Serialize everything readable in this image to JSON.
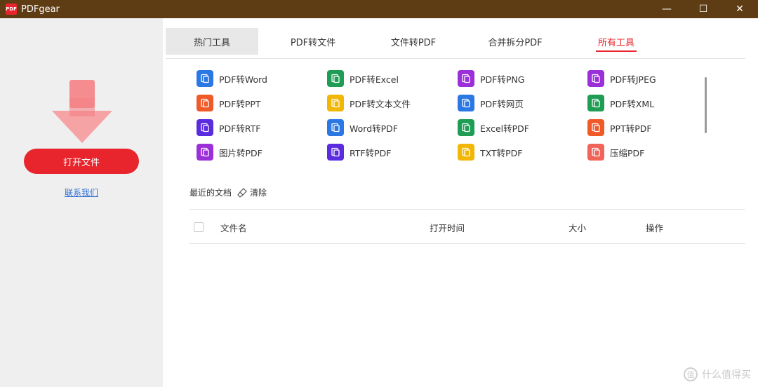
{
  "window": {
    "title": "PDFgear",
    "logo_text": "PDF",
    "minimize": "—",
    "maximize": "☐",
    "close": "✕"
  },
  "sidebar": {
    "open_file": "打开文件",
    "contact_us": "联系我们"
  },
  "tabs": [
    {
      "label": "热门工具"
    },
    {
      "label": "PDF转文件"
    },
    {
      "label": "文件转PDF"
    },
    {
      "label": "合并拆分PDF"
    },
    {
      "label": "所有工具"
    }
  ],
  "tools": [
    {
      "label": "PDF转Word",
      "color": "#2b78e4",
      "icon": "word-icon"
    },
    {
      "label": "PDF转Excel",
      "color": "#1f9d55",
      "icon": "excel-icon"
    },
    {
      "label": "PDF转PNG",
      "color": "#9b30d9",
      "icon": "png-icon"
    },
    {
      "label": "PDF转JPEG",
      "color": "#9b30d9",
      "icon": "jpeg-icon"
    },
    {
      "label": "PDF转PPT",
      "color": "#f05a28",
      "icon": "ppt-icon"
    },
    {
      "label": "PDF转文本文件",
      "color": "#f2b705",
      "icon": "text-icon"
    },
    {
      "label": "PDF转网页",
      "color": "#2b78e4",
      "icon": "web-icon"
    },
    {
      "label": "PDF转XML",
      "color": "#1f9d55",
      "icon": "xml-icon"
    },
    {
      "label": "PDF转RTF",
      "color": "#5b2be0",
      "icon": "rtf-icon"
    },
    {
      "label": "Word转PDF",
      "color": "#2b78e4",
      "icon": "word-to-pdf-icon"
    },
    {
      "label": "Excel转PDF",
      "color": "#1f9d55",
      "icon": "excel-to-pdf-icon"
    },
    {
      "label": "PPT转PDF",
      "color": "#f05a28",
      "icon": "ppt-to-pdf-icon"
    },
    {
      "label": "图片转PDF",
      "color": "#9b30d9",
      "icon": "image-to-pdf-icon"
    },
    {
      "label": "RTF转PDF",
      "color": "#5b2be0",
      "icon": "rtf-to-pdf-icon"
    },
    {
      "label": "TXT转PDF",
      "color": "#f2b705",
      "icon": "txt-to-pdf-icon"
    },
    {
      "label": "压缩PDF",
      "color": "#f0645a",
      "icon": "compress-icon"
    }
  ],
  "recent": {
    "title": "最近的文档",
    "clear": "清除"
  },
  "table": {
    "col_name": "文件名",
    "col_time": "打开时间",
    "col_size": "大小",
    "col_action": "操作"
  },
  "watermark": {
    "symbol": "值",
    "text": "什么值得买"
  }
}
